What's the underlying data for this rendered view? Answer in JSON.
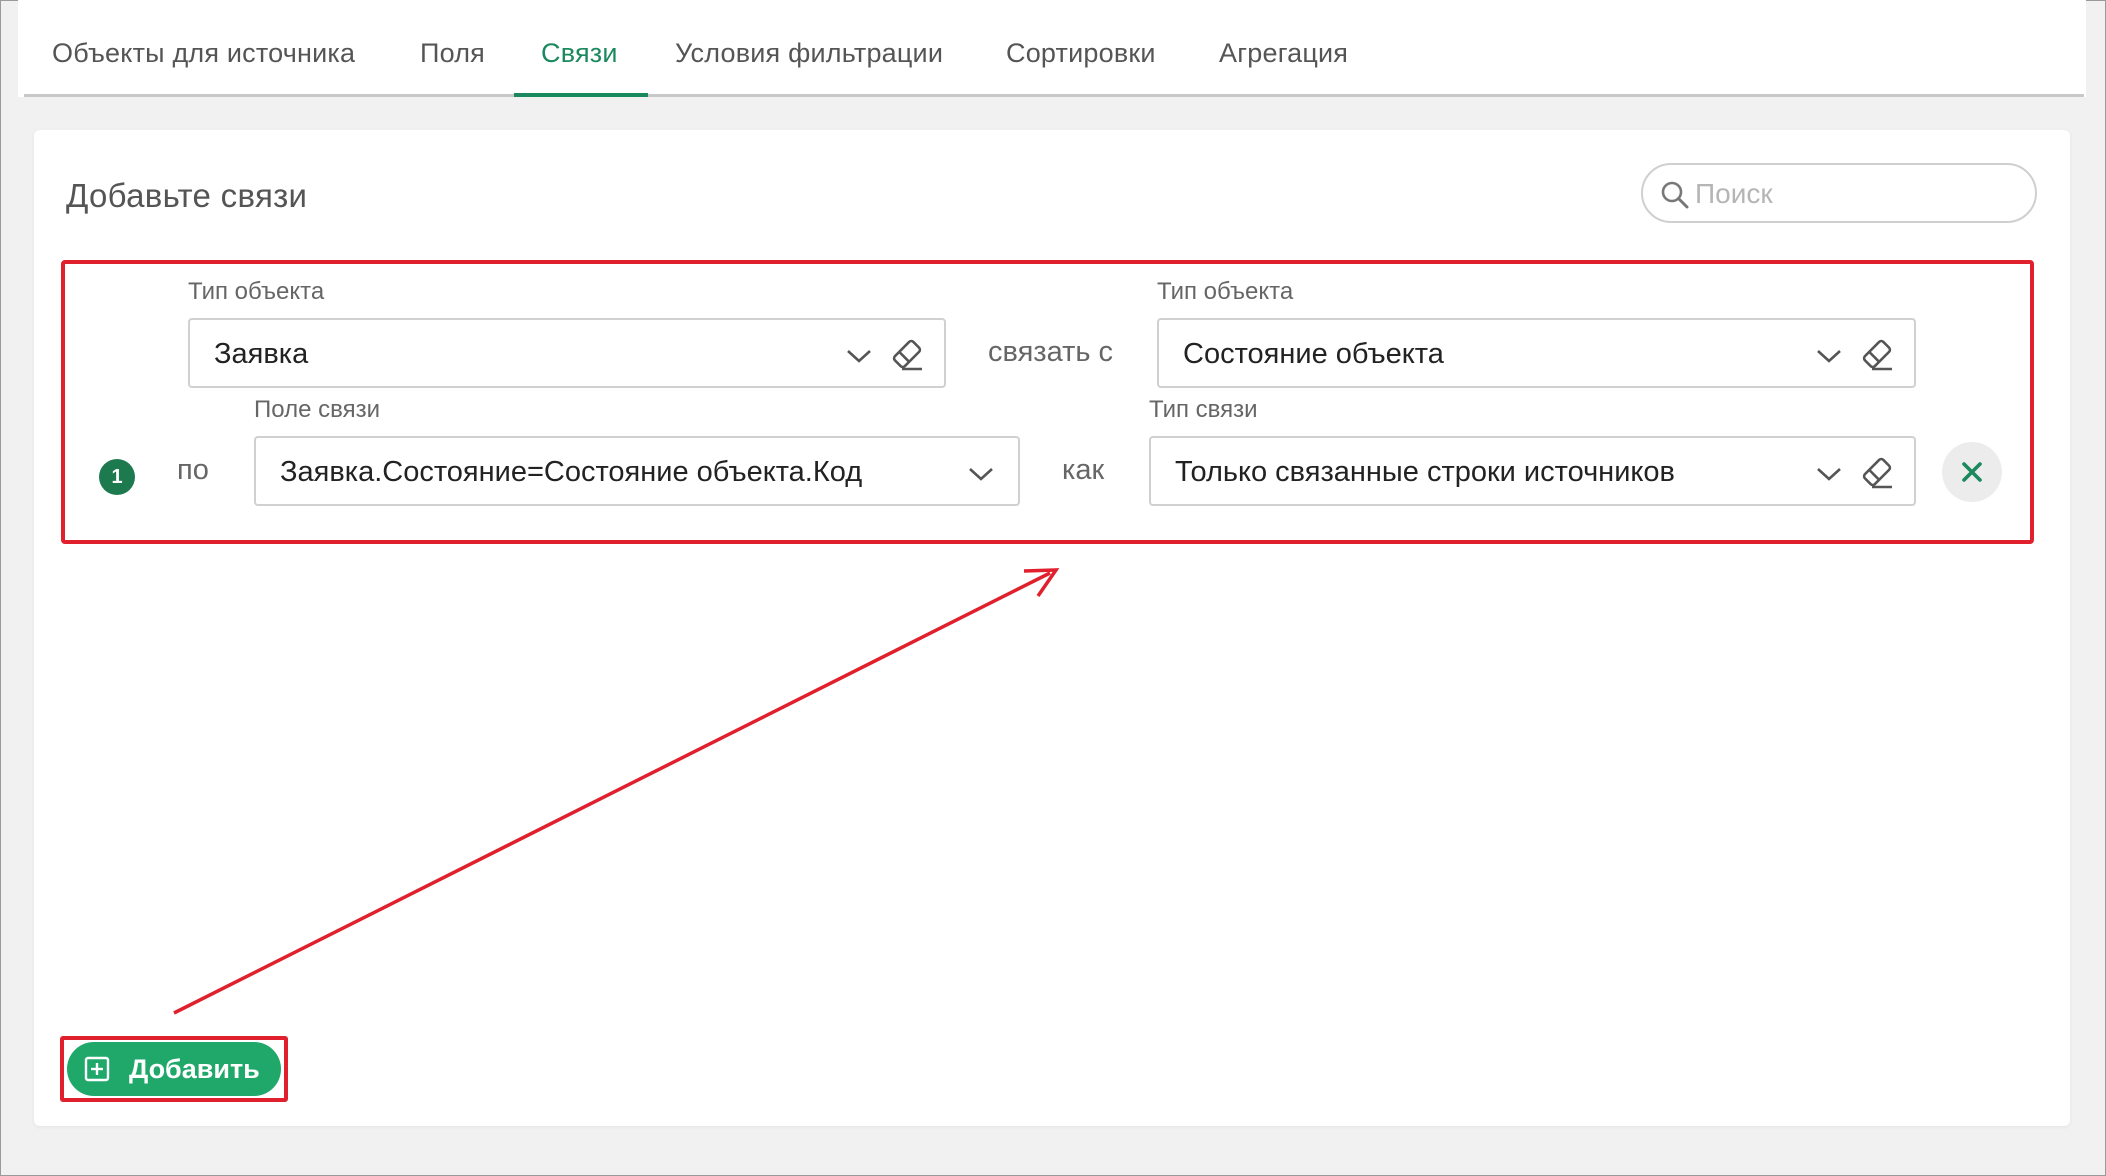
{
  "tabs": [
    {
      "label": "Объекты для источника",
      "active": false
    },
    {
      "label": "Поля",
      "active": false
    },
    {
      "label": "Связи",
      "active": true
    },
    {
      "label": "Условия фильтрации",
      "active": false
    },
    {
      "label": "Сортировки",
      "active": false
    },
    {
      "label": "Агрегация",
      "active": false
    }
  ],
  "panel": {
    "title": "Добавьте связи",
    "search_placeholder": "Поиск"
  },
  "relation": {
    "number": "1",
    "left_type_label": "Тип объекта",
    "left_type_value": "Заявка",
    "link_with": "связать с",
    "right_type_label": "Тип объекта",
    "right_type_value": "Состояние объекта",
    "by": "по",
    "field_label": "Поле связи",
    "field_value": "Заявка.Состояние=Состояние объекта.Код",
    "as": "как",
    "link_type_label": "Тип связи",
    "link_type_value": "Только связанные строки источников"
  },
  "add_button": {
    "label": "Добавить"
  },
  "colors": {
    "accent": "#1a8a5e",
    "button_green": "#1fa86a",
    "badge_green": "#1d7a4e",
    "annotation_red": "#e0202d"
  },
  "icons": [
    "search-icon",
    "chevron-down-icon",
    "eraser-icon",
    "close-icon",
    "plus-square-icon"
  ]
}
